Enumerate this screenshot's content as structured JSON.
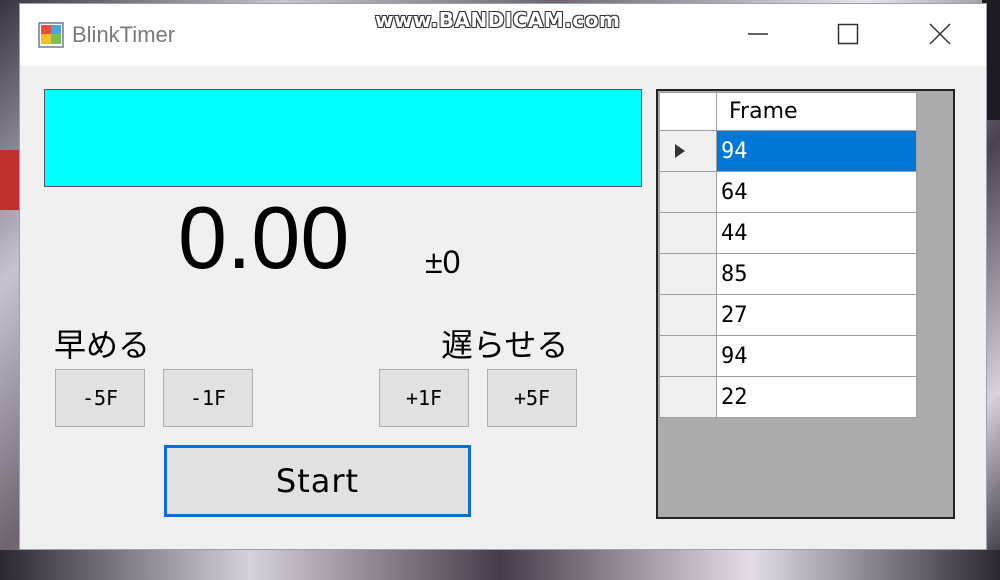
{
  "window": {
    "title": "BlinkTimer",
    "watermark": "www.BANDICAM.com"
  },
  "display": {
    "panel_color": "#00ffff",
    "timer": "0.00",
    "offset": "±0"
  },
  "controls": {
    "earlier_label": "早める",
    "later_label": "遅らせる",
    "minus5_label": "-5F",
    "minus1_label": "-1F",
    "plus1_label": "+1F",
    "plus5_label": "+5F",
    "start_label": "Start"
  },
  "grid": {
    "column_header": "Frame",
    "rows": [
      "94",
      "64",
      "44",
      "85",
      "27",
      "94",
      "22"
    ],
    "selected_index": 0
  },
  "icons": {
    "minimize": "minimize-icon",
    "maximize": "maximize-icon",
    "close": "close-icon",
    "app": "app-icon",
    "row_pointer": "row-pointer-icon"
  },
  "colors": {
    "selection": "#0078d7",
    "start_border": "#0a6fcf"
  }
}
